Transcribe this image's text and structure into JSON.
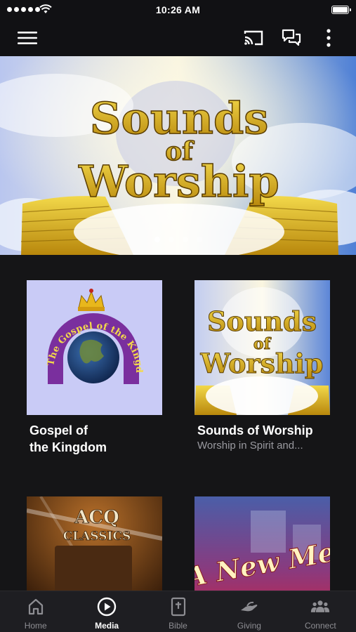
{
  "status_bar": {
    "time": "10:26 AM"
  },
  "hero": {
    "title_line1": "Sounds",
    "title_line2": "of",
    "title_line3": "Worship",
    "active_slide": 1,
    "slide_count": 4
  },
  "media": [
    {
      "title": "Gospel of\nthe Kingdom",
      "subtitle": "",
      "logo_text": "The Gospel of the Kingdom"
    },
    {
      "title": "Sounds of Worship",
      "subtitle": "Worship in Spirit and...",
      "art_line1": "Sounds",
      "art_line2": "of",
      "art_line3": "Worship"
    },
    {
      "title": "",
      "subtitle": "",
      "art_line1": "ACQ",
      "art_line2": "CLASSICS"
    },
    {
      "title": "",
      "subtitle": "",
      "art_text": "A New Me"
    }
  ],
  "tabs": [
    {
      "label": "Home",
      "icon": "home-icon"
    },
    {
      "label": "Media",
      "icon": "play-circle-icon"
    },
    {
      "label": "Bible",
      "icon": "bible-icon"
    },
    {
      "label": "Giving",
      "icon": "giving-hand-icon"
    },
    {
      "label": "Connect",
      "icon": "people-icon"
    }
  ],
  "active_tab": "Media",
  "colors": {
    "background": "#151517",
    "bar": "#111114",
    "tab_bar": "#1e1e22",
    "gold": "#d8b81e",
    "purple": "#7a2f9e",
    "inactive": "#8e8e93"
  }
}
